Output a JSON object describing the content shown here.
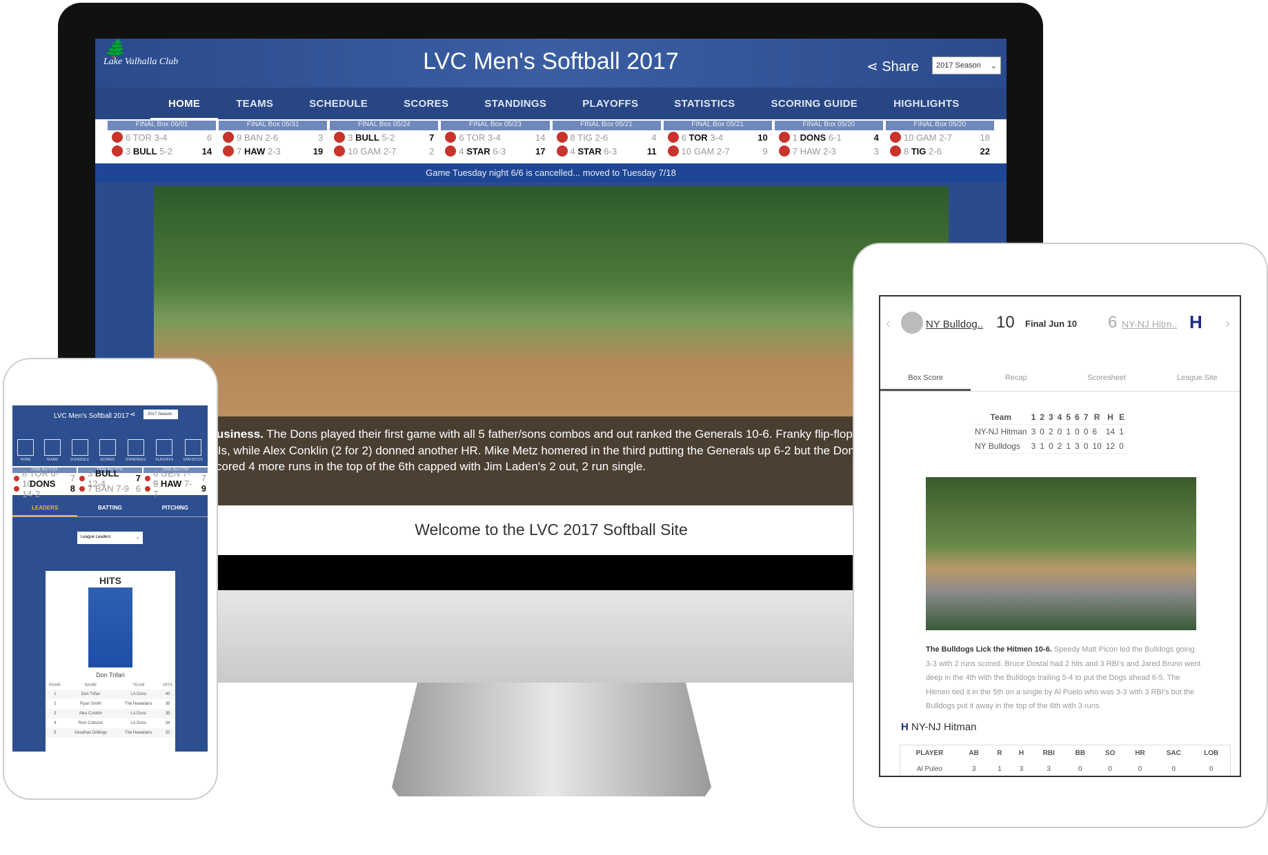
{
  "desktop": {
    "logo": "Lake Valhalla Club",
    "title": "LVC Men's Softball 2017",
    "share_label": "Share",
    "season_select": "2017 Season",
    "nav": [
      "HOME",
      "TEAMS",
      "SCHEDULE",
      "SCORES",
      "STANDINGS",
      "PLAYOFFS",
      "STATISTICS",
      "SCORING GUIDE",
      "HIGHLIGHTS"
    ],
    "active_nav": "HOME",
    "games": [
      {
        "header": "FINAL Box 06/01",
        "t1": {
          "seed": "6",
          "abbr": "TOR",
          "rec": "3-4",
          "score": "6"
        },
        "t2": {
          "seed": "3",
          "abbr": "BULL",
          "rec": "5-2",
          "score": "14"
        },
        "winner": 2
      },
      {
        "header": "FINAL Box 05/31",
        "t1": {
          "seed": "9",
          "abbr": "BAN",
          "rec": "2-6",
          "score": "3"
        },
        "t2": {
          "seed": "7",
          "abbr": "HAW",
          "rec": "2-3",
          "score": "19"
        },
        "winner": 2
      },
      {
        "header": "FINAL Box 05/24",
        "t1": {
          "seed": "3",
          "abbr": "BULL",
          "rec": "5-2",
          "score": "7"
        },
        "t2": {
          "seed": "10",
          "abbr": "GAM",
          "rec": "2-7",
          "score": "2"
        },
        "winner": 1
      },
      {
        "header": "FINAL Box 05/23",
        "t1": {
          "seed": "6",
          "abbr": "TOR",
          "rec": "3-4",
          "score": "14"
        },
        "t2": {
          "seed": "4",
          "abbr": "STAR",
          "rec": "6-3",
          "score": "17"
        },
        "winner": 2
      },
      {
        "header": "FINAL Box 05/21",
        "t1": {
          "seed": "8",
          "abbr": "TIG",
          "rec": "2-6",
          "score": "4"
        },
        "t2": {
          "seed": "4",
          "abbr": "STAR",
          "rec": "6-3",
          "score": "11"
        },
        "winner": 2
      },
      {
        "header": "FINAL Box 05/21",
        "t1": {
          "seed": "6",
          "abbr": "TOR",
          "rec": "3-4",
          "score": "10"
        },
        "t2": {
          "seed": "10",
          "abbr": "GAM",
          "rec": "2-7",
          "score": "9"
        },
        "winner": 1
      },
      {
        "header": "FINAL Box 05/20",
        "t1": {
          "seed": "1",
          "abbr": "DONS",
          "rec": "6-1",
          "score": "4"
        },
        "t2": {
          "seed": "7",
          "abbr": "HAW",
          "rec": "2-3",
          "score": "3"
        },
        "winner": 1
      },
      {
        "header": "FINAL Box 05/20",
        "t1": {
          "seed": "10",
          "abbr": "GAM",
          "rec": "2-7",
          "score": "18"
        },
        "t2": {
          "seed": "8",
          "abbr": "TIG",
          "rec": "2-6",
          "score": "22"
        },
        "winner": 2
      }
    ],
    "notice": "Game Tuesday night 6/6 is cancelled... moved to Tuesday 7/18",
    "caption_bold": "Family Business.",
    "caption_text": " The Dons played their first game with all 5 father/sons combos and out ranked the Generals 10-6. Franky flip-flops led the way with 3 RBIs, while Alex Conklin (2 for 2) donned another HR. Mike Metz homered in the third putting the Generals up 6-2 but the Dons tied it in the 5th and scored 4 more runs in the top of the 6th capped with Jim Laden's 2 out, 2 run single.",
    "welcome": "Welcome to the LVC 2017 Softball Site"
  },
  "tablet": {
    "home_team": "NY Bulldog..",
    "home_score": "10",
    "status": "Final Jun 10",
    "away_score": "6",
    "away_team": "NY-NJ Hitm..",
    "tabs": [
      "Box Score",
      "Recap",
      "Scoresheet",
      "League Site"
    ],
    "linescore": {
      "headers": [
        "Team",
        "1",
        "2",
        "3",
        "4",
        "5",
        "6",
        "7",
        "R",
        "H",
        "E"
      ],
      "rows": [
        [
          "NY-NJ Hitman",
          "3",
          "0",
          "2",
          "0",
          "1",
          "0",
          "0",
          "6",
          "14",
          "1"
        ],
        [
          "NY Bulldogs",
          "3",
          "1",
          "0",
          "2",
          "1",
          "3",
          "0",
          "10",
          "12",
          "0"
        ]
      ]
    },
    "recap_bold": "The Bulldogs Lick the Hitmen 10-6.",
    "recap_text": " Speedy Matt Picon led the Bulldogs going 3-3 with 2 runs scored. Bruce Dostal had 2 hits and 3 RBI's and Jared Bruno went deep in the 4th with the Bulldogs trailing 5-4 to put the Dogs ahead 6-5. The Hitmen tied it in the 5th on a single by Al Puelo who was 3-3 with 3 RBI's but the Bulldogs put it away in the top of the 6th with 3 runs.",
    "team_heading": "NY-NJ Hitman",
    "batting": {
      "headers": [
        "PLAYER",
        "AB",
        "R",
        "H",
        "RBI",
        "BB",
        "SO",
        "HR",
        "SAC",
        "LOB"
      ],
      "rows": [
        [
          "Al Puleo",
          "3",
          "1",
          "3",
          "3",
          "0",
          "0",
          "0",
          "0",
          "0"
        ]
      ]
    }
  },
  "phone": {
    "title": "LVC Men's Softball 2017",
    "season_select": "2017 Season",
    "icons": [
      "HOME",
      "TEAMS",
      "SCHEDULE",
      "SCORES",
      "STANDINGS",
      "PLAYOFFS",
      "STATISTICS"
    ],
    "games": [
      {
        "header": "FINAL Box 07/16",
        "t1": {
          "seed": "8",
          "abbr": "TOR",
          "rec": "6-10",
          "score": "7"
        },
        "t2": {
          "seed": "1",
          "abbr": "DONS",
          "rec": "14-2",
          "score": "8"
        },
        "winner": 2
      },
      {
        "header": "FINAL Box 07/11",
        "t1": {
          "seed": "3",
          "abbr": "BULL",
          "rec": "12-4",
          "score": "7"
        },
        "t2": {
          "seed": "7",
          "abbr": "BAN",
          "rec": "7-9",
          "score": "6"
        },
        "winner": 1
      },
      {
        "header": "FINAL Box 07/09",
        "t1": {
          "seed": "6",
          "abbr": "GEN",
          "rec": "7-9",
          "score": "7"
        },
        "t2": {
          "seed": "5",
          "abbr": "HAW",
          "rec": "7-7",
          "score": "9"
        },
        "winner": 2
      }
    ],
    "tabs": [
      "LEADERS",
      "BATTING",
      "PITCHING"
    ],
    "leaders_select": "League Leaders",
    "card_title": "HITS",
    "leader_name": "Don Trifari",
    "table": {
      "headers": [
        "RANK",
        "NAME",
        "TEAM",
        "HITS"
      ],
      "rows": [
        [
          "1",
          "Don Trifari",
          "LA Dons",
          "40"
        ],
        [
          "2",
          "Ryan Smith",
          "The Hawaiians",
          "38"
        ],
        [
          "3",
          "Alex Conklin",
          "LA Dons",
          "35"
        ],
        [
          "4",
          "Rich Cobuzio",
          "LA Dons",
          "34"
        ],
        [
          "5",
          "Jonathan Drillings",
          "The Hawaiians",
          "32"
        ]
      ]
    }
  },
  "colors": {
    "brand_blue": "#2b4c8c",
    "nav_gold": "#e8b830",
    "caption_bg": "#1e1e1e"
  }
}
